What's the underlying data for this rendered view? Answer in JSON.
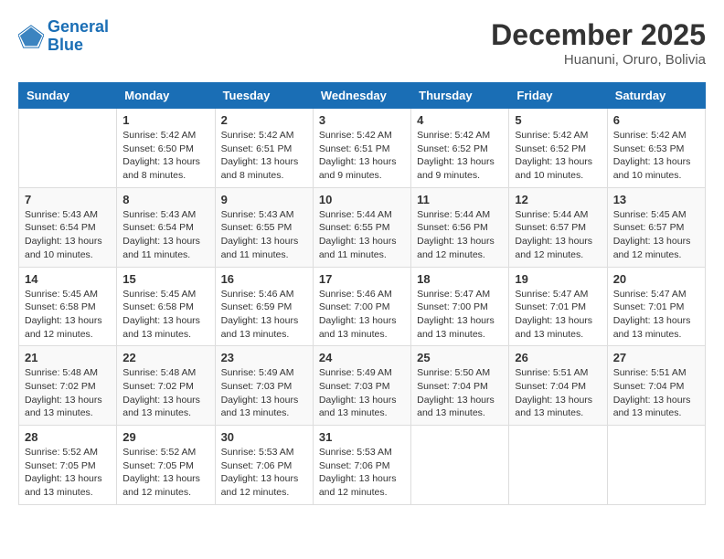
{
  "header": {
    "logo_line1": "General",
    "logo_line2": "Blue",
    "month": "December 2025",
    "location": "Huanuni, Oruro, Bolivia"
  },
  "weekdays": [
    "Sunday",
    "Monday",
    "Tuesday",
    "Wednesday",
    "Thursday",
    "Friday",
    "Saturday"
  ],
  "weeks": [
    [
      {
        "day": "",
        "sunrise": "",
        "sunset": "",
        "daylight": ""
      },
      {
        "day": "1",
        "sunrise": "Sunrise: 5:42 AM",
        "sunset": "Sunset: 6:50 PM",
        "daylight": "Daylight: 13 hours and 8 minutes."
      },
      {
        "day": "2",
        "sunrise": "Sunrise: 5:42 AM",
        "sunset": "Sunset: 6:51 PM",
        "daylight": "Daylight: 13 hours and 8 minutes."
      },
      {
        "day": "3",
        "sunrise": "Sunrise: 5:42 AM",
        "sunset": "Sunset: 6:51 PM",
        "daylight": "Daylight: 13 hours and 9 minutes."
      },
      {
        "day": "4",
        "sunrise": "Sunrise: 5:42 AM",
        "sunset": "Sunset: 6:52 PM",
        "daylight": "Daylight: 13 hours and 9 minutes."
      },
      {
        "day": "5",
        "sunrise": "Sunrise: 5:42 AM",
        "sunset": "Sunset: 6:52 PM",
        "daylight": "Daylight: 13 hours and 10 minutes."
      },
      {
        "day": "6",
        "sunrise": "Sunrise: 5:42 AM",
        "sunset": "Sunset: 6:53 PM",
        "daylight": "Daylight: 13 hours and 10 minutes."
      }
    ],
    [
      {
        "day": "7",
        "sunrise": "Sunrise: 5:43 AM",
        "sunset": "Sunset: 6:54 PM",
        "daylight": "Daylight: 13 hours and 10 minutes."
      },
      {
        "day": "8",
        "sunrise": "Sunrise: 5:43 AM",
        "sunset": "Sunset: 6:54 PM",
        "daylight": "Daylight: 13 hours and 11 minutes."
      },
      {
        "day": "9",
        "sunrise": "Sunrise: 5:43 AM",
        "sunset": "Sunset: 6:55 PM",
        "daylight": "Daylight: 13 hours and 11 minutes."
      },
      {
        "day": "10",
        "sunrise": "Sunrise: 5:44 AM",
        "sunset": "Sunset: 6:55 PM",
        "daylight": "Daylight: 13 hours and 11 minutes."
      },
      {
        "day": "11",
        "sunrise": "Sunrise: 5:44 AM",
        "sunset": "Sunset: 6:56 PM",
        "daylight": "Daylight: 13 hours and 12 minutes."
      },
      {
        "day": "12",
        "sunrise": "Sunrise: 5:44 AM",
        "sunset": "Sunset: 6:57 PM",
        "daylight": "Daylight: 13 hours and 12 minutes."
      },
      {
        "day": "13",
        "sunrise": "Sunrise: 5:45 AM",
        "sunset": "Sunset: 6:57 PM",
        "daylight": "Daylight: 13 hours and 12 minutes."
      }
    ],
    [
      {
        "day": "14",
        "sunrise": "Sunrise: 5:45 AM",
        "sunset": "Sunset: 6:58 PM",
        "daylight": "Daylight: 13 hours and 12 minutes."
      },
      {
        "day": "15",
        "sunrise": "Sunrise: 5:45 AM",
        "sunset": "Sunset: 6:58 PM",
        "daylight": "Daylight: 13 hours and 13 minutes."
      },
      {
        "day": "16",
        "sunrise": "Sunrise: 5:46 AM",
        "sunset": "Sunset: 6:59 PM",
        "daylight": "Daylight: 13 hours and 13 minutes."
      },
      {
        "day": "17",
        "sunrise": "Sunrise: 5:46 AM",
        "sunset": "Sunset: 7:00 PM",
        "daylight": "Daylight: 13 hours and 13 minutes."
      },
      {
        "day": "18",
        "sunrise": "Sunrise: 5:47 AM",
        "sunset": "Sunset: 7:00 PM",
        "daylight": "Daylight: 13 hours and 13 minutes."
      },
      {
        "day": "19",
        "sunrise": "Sunrise: 5:47 AM",
        "sunset": "Sunset: 7:01 PM",
        "daylight": "Daylight: 13 hours and 13 minutes."
      },
      {
        "day": "20",
        "sunrise": "Sunrise: 5:47 AM",
        "sunset": "Sunset: 7:01 PM",
        "daylight": "Daylight: 13 hours and 13 minutes."
      }
    ],
    [
      {
        "day": "21",
        "sunrise": "Sunrise: 5:48 AM",
        "sunset": "Sunset: 7:02 PM",
        "daylight": "Daylight: 13 hours and 13 minutes."
      },
      {
        "day": "22",
        "sunrise": "Sunrise: 5:48 AM",
        "sunset": "Sunset: 7:02 PM",
        "daylight": "Daylight: 13 hours and 13 minutes."
      },
      {
        "day": "23",
        "sunrise": "Sunrise: 5:49 AM",
        "sunset": "Sunset: 7:03 PM",
        "daylight": "Daylight: 13 hours and 13 minutes."
      },
      {
        "day": "24",
        "sunrise": "Sunrise: 5:49 AM",
        "sunset": "Sunset: 7:03 PM",
        "daylight": "Daylight: 13 hours and 13 minutes."
      },
      {
        "day": "25",
        "sunrise": "Sunrise: 5:50 AM",
        "sunset": "Sunset: 7:04 PM",
        "daylight": "Daylight: 13 hours and 13 minutes."
      },
      {
        "day": "26",
        "sunrise": "Sunrise: 5:51 AM",
        "sunset": "Sunset: 7:04 PM",
        "daylight": "Daylight: 13 hours and 13 minutes."
      },
      {
        "day": "27",
        "sunrise": "Sunrise: 5:51 AM",
        "sunset": "Sunset: 7:04 PM",
        "daylight": "Daylight: 13 hours and 13 minutes."
      }
    ],
    [
      {
        "day": "28",
        "sunrise": "Sunrise: 5:52 AM",
        "sunset": "Sunset: 7:05 PM",
        "daylight": "Daylight: 13 hours and 13 minutes."
      },
      {
        "day": "29",
        "sunrise": "Sunrise: 5:52 AM",
        "sunset": "Sunset: 7:05 PM",
        "daylight": "Daylight: 13 hours and 12 minutes."
      },
      {
        "day": "30",
        "sunrise": "Sunrise: 5:53 AM",
        "sunset": "Sunset: 7:06 PM",
        "daylight": "Daylight: 13 hours and 12 minutes."
      },
      {
        "day": "31",
        "sunrise": "Sunrise: 5:53 AM",
        "sunset": "Sunset: 7:06 PM",
        "daylight": "Daylight: 13 hours and 12 minutes."
      },
      {
        "day": "",
        "sunrise": "",
        "sunset": "",
        "daylight": ""
      },
      {
        "day": "",
        "sunrise": "",
        "sunset": "",
        "daylight": ""
      },
      {
        "day": "",
        "sunrise": "",
        "sunset": "",
        "daylight": ""
      }
    ]
  ]
}
